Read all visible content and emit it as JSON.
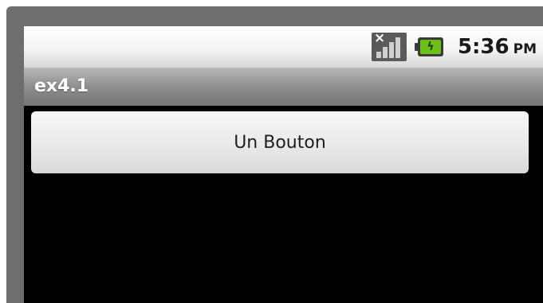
{
  "status_bar": {
    "signal_icon": "signal-no-service-icon",
    "battery_icon": "battery-charging-icon",
    "time": "5:36",
    "am_pm": "PM"
  },
  "title_bar": {
    "title": "ex4.1"
  },
  "content": {
    "button_label": "Un Bouton"
  },
  "colors": {
    "battery_fill": "#6bc118",
    "title_bar": "#8e8e8e",
    "background": "#000000"
  }
}
